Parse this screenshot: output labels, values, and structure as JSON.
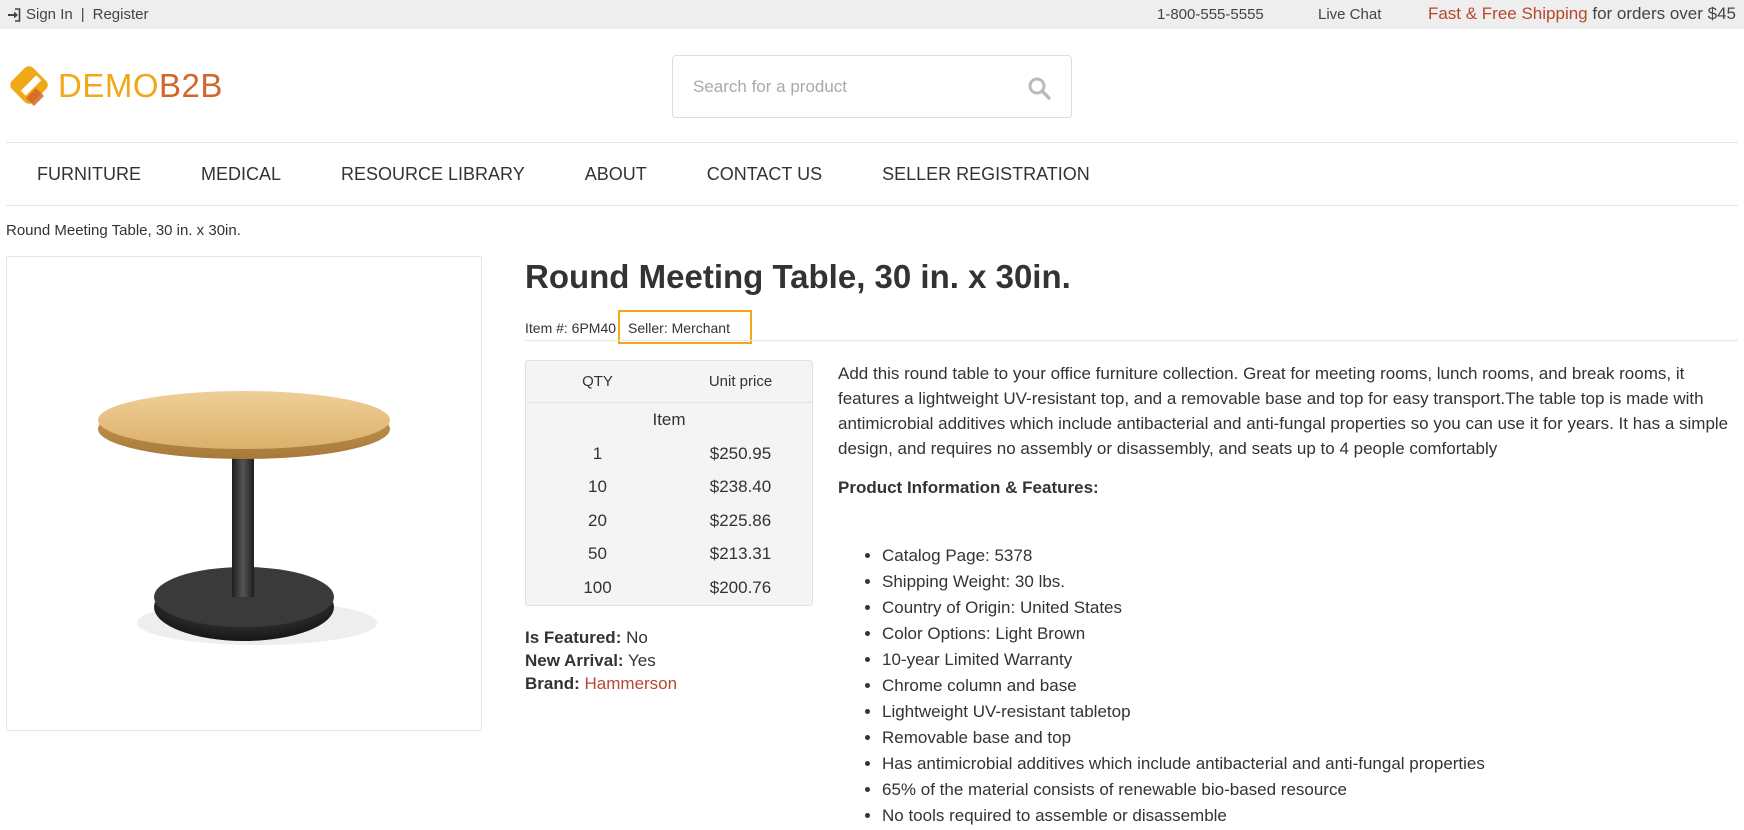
{
  "topbar": {
    "sign_in": "Sign In",
    "separator": "|",
    "register": "Register",
    "phone": "1-800-555-5555",
    "live_chat": "Live Chat",
    "shipping_highlight": "Fast & Free Shipping",
    "shipping_rest": " for orders over $45"
  },
  "header": {
    "logo_part1": "DEMO",
    "logo_part2": "B2B",
    "search_placeholder": "Search for a product"
  },
  "nav": {
    "items": [
      "FURNITURE",
      "MEDICAL",
      "RESOURCE LIBRARY",
      "ABOUT",
      "CONTACT US",
      "SELLER REGISTRATION"
    ]
  },
  "breadcrumb": "Round Meeting Table, 30 in. x 30in.",
  "product": {
    "title": "Round Meeting Table, 30 in. x 30in.",
    "item_number": "Item #: 6PM40",
    "seller": "Seller: Merchant",
    "price_table": {
      "col_qty": "QTY",
      "col_price": "Unit price",
      "group_label": "Item",
      "rows": [
        {
          "qty": "1",
          "price": "$250.95"
        },
        {
          "qty": "10",
          "price": "$238.40"
        },
        {
          "qty": "20",
          "price": "$225.86"
        },
        {
          "qty": "50",
          "price": "$213.31"
        },
        {
          "qty": "100",
          "price": "$200.76"
        }
      ]
    },
    "is_featured_label": "Is Featured:",
    "is_featured_value": "No",
    "new_arrival_label": "New Arrival:",
    "new_arrival_value": "Yes",
    "brand_label": "Brand:",
    "brand_value": "Hammerson",
    "description": "Add this round table to your office furniture collection. Great for meeting rooms, lunch rooms, and break rooms, it features a lightweight UV-resistant top, and a removable base and top for easy transport.The table top is made with antimicrobial additives which include antibacterial and anti-fungal properties so you can use it for years. It has a simple design, and requires no assembly or disassembly, and seats up to 4 people comfortably",
    "features_title": "Product Information & Features:",
    "features": [
      "Catalog Page: 5378",
      "Shipping Weight: 30 lbs.",
      "Country of Origin: United States",
      "Color Options: Light Brown",
      "10-year Limited Warranty",
      "Chrome column and base",
      "Lightweight UV-resistant tabletop",
      "Removable base and top",
      "Has antimicrobial additives which include antibacterial and anti-fungal properties",
      "65% of the material consists of renewable bio-based resource",
      "No tools required to assemble or disassemble"
    ]
  },
  "colors": {
    "accent": "#b5482d",
    "logo_yellow": "#f0a818",
    "logo_orange": "#d2662a",
    "highlight_border": "#f0a818"
  },
  "icons": {
    "sign_in": "sign-in-icon",
    "search": "search-icon"
  }
}
